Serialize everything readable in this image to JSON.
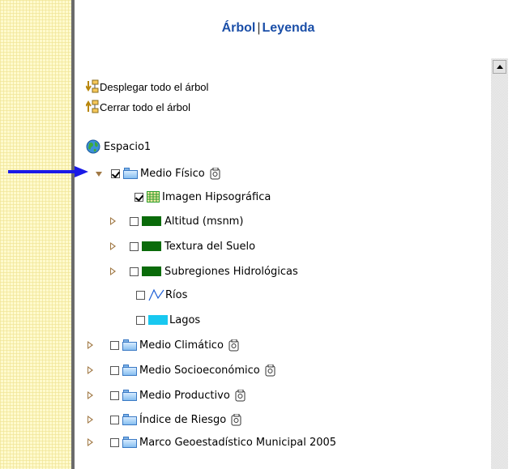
{
  "header": {
    "tab_tree": "Árbol",
    "separator": "|",
    "tab_legend": "Leyenda"
  },
  "actions": {
    "expand_all": "Desplegar todo el árbol",
    "collapse_all": "Cerrar todo el árbol"
  },
  "tree": {
    "root": "Espacio1",
    "medio_fisico": {
      "label": "Medio Físico",
      "checked": true,
      "children": [
        {
          "label": "Imagen Hipsográfica",
          "checked": true,
          "icon": "grid-icon",
          "color": "#2a9d2a"
        },
        {
          "label": "Altitud (msnm)",
          "checked": false,
          "icon": "color-swatch",
          "color": "#0a6b0a"
        },
        {
          "label": "Textura del Suelo",
          "checked": false,
          "icon": "color-swatch",
          "color": "#0a6b0a"
        },
        {
          "label": "Subregiones Hidrológicas",
          "checked": false,
          "icon": "color-swatch",
          "color": "#0a6b0a"
        },
        {
          "label": "Ríos",
          "checked": false,
          "icon": "line-icon",
          "color": "#1f5fd6"
        },
        {
          "label": "Lagos",
          "checked": false,
          "icon": "color-swatch",
          "color": "#18c8f0"
        }
      ]
    },
    "groups": [
      {
        "label": "Medio Climático",
        "info": true
      },
      {
        "label": "Medio Socioeconómico",
        "info": true
      },
      {
        "label": "Medio Productivo",
        "info": true
      },
      {
        "label": "Índice de Riesgo",
        "info": true
      },
      {
        "label": "Marco Geoestadístico Municipal 2005",
        "info": false
      }
    ]
  },
  "colors": {
    "header_text": "#1b4fa8",
    "pointer_arrow": "#1a1ae6",
    "left_panel": "#fffacd"
  }
}
